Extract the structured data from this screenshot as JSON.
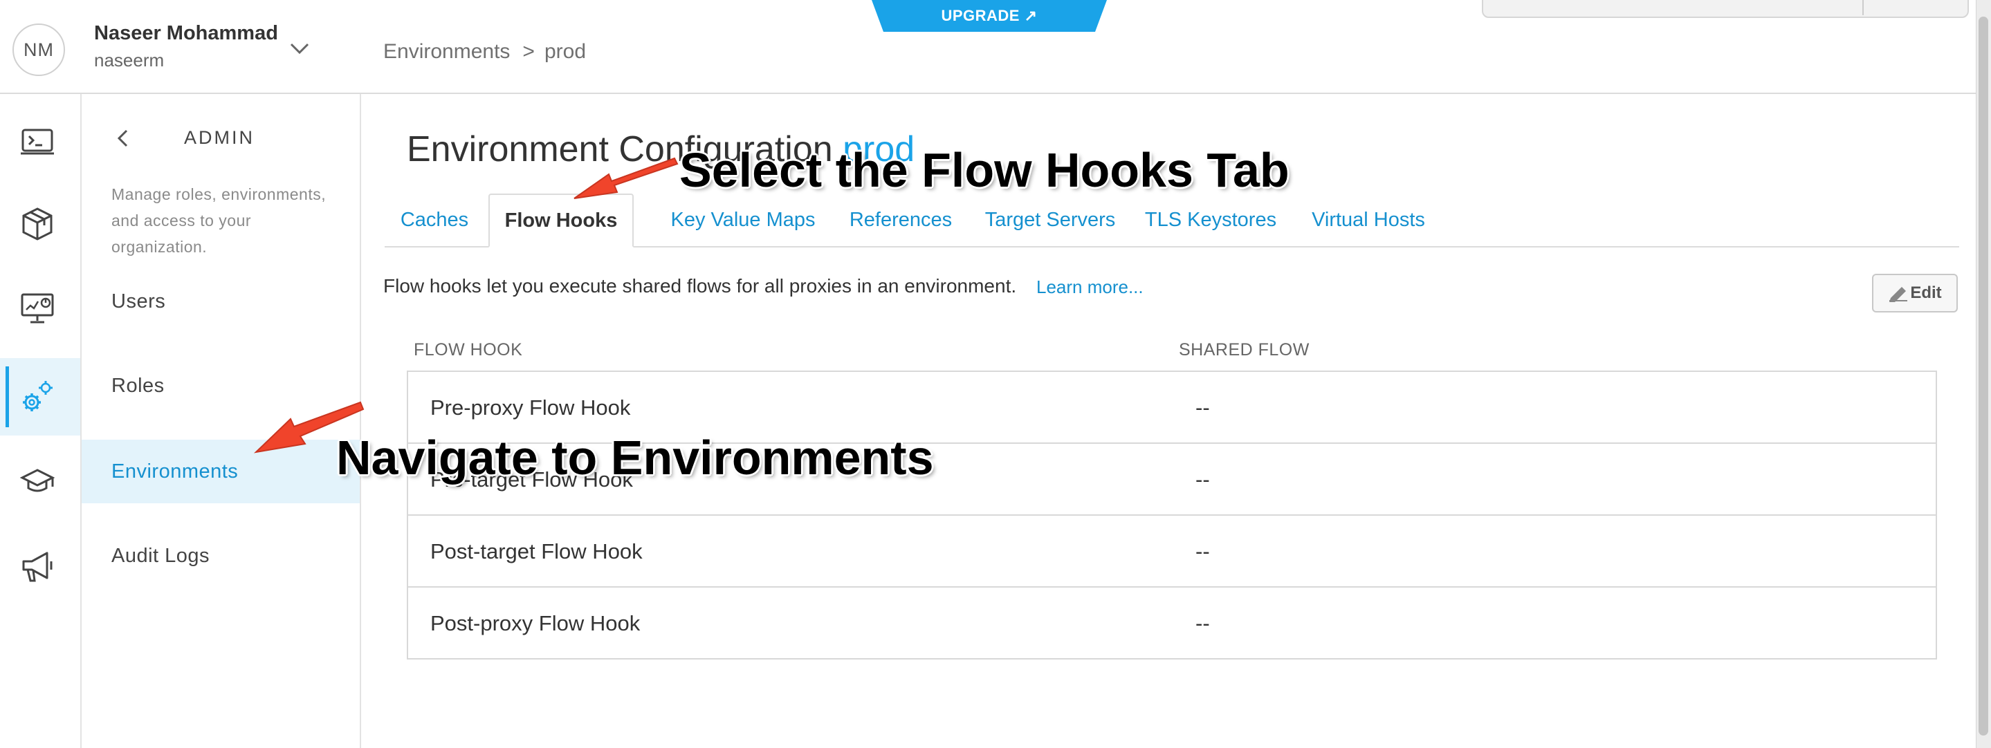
{
  "user": {
    "initials": "NM",
    "name": "Naseer Mohammad",
    "username": "naseerm"
  },
  "breadcrumb": {
    "root": "Environments",
    "separator": ">",
    "current": "prod"
  },
  "upgrade": {
    "label": "UPGRADE ↗"
  },
  "rail": {
    "icons": [
      "terminal-icon",
      "package-icon",
      "analytics-monitor-icon",
      "admin-gears-icon",
      "graduation-cap-icon",
      "megaphone-icon"
    ],
    "active": "admin-gears-icon",
    "accent_color": "#1aa3e8"
  },
  "admin": {
    "title": "ADMIN",
    "description": "Manage roles, environments, and access to your organization.",
    "nav": [
      "Users",
      "Roles",
      "Environments",
      "Audit Logs"
    ],
    "active_nav": "Environments"
  },
  "page": {
    "title": "Environment Configuration",
    "environment": "prod",
    "tabs": [
      "Caches",
      "Flow Hooks",
      "Key Value Maps",
      "References",
      "Target Servers",
      "TLS Keystores",
      "Virtual Hosts"
    ],
    "active_tab": "Flow Hooks",
    "info": "Flow hooks let you execute shared flows for all proxies in an environment.",
    "learn_more": "Learn more...",
    "edit_label": "Edit"
  },
  "table": {
    "headers": [
      "FLOW HOOK",
      "SHARED FLOW"
    ],
    "rows": [
      {
        "hook": "Pre-proxy Flow Hook",
        "shared": "--"
      },
      {
        "hook": "Pre-target Flow Hook",
        "shared": "--"
      },
      {
        "hook": "Post-target Flow Hook",
        "shared": "--"
      },
      {
        "hook": "Post-proxy Flow Hook",
        "shared": "--"
      }
    ]
  },
  "annotations": {
    "tab_callout": "Select the Flow Hooks Tab",
    "env_callout": "Navigate to Environments",
    "arrow_color": "#f0442b"
  }
}
